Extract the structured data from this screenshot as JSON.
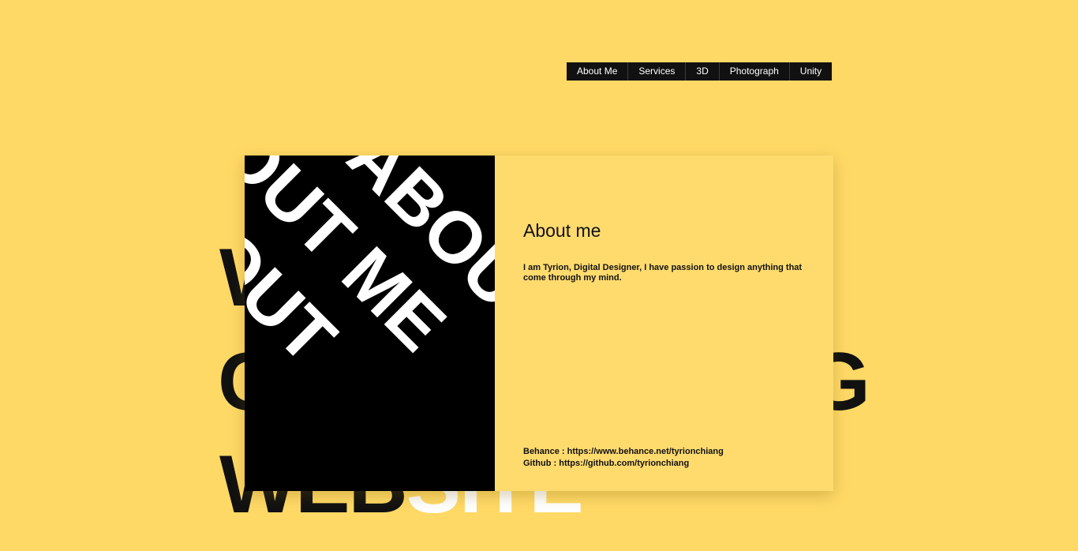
{
  "nav": {
    "items": [
      {
        "label": "About Me"
      },
      {
        "label": "Services"
      },
      {
        "label": "3D"
      },
      {
        "label": "Photograph"
      },
      {
        "label": "Unity"
      }
    ]
  },
  "background_words": {
    "line1": "W",
    "line2_left": "C",
    "line2_right": "G",
    "line3_dark": "WEB",
    "line3_light": "SITE"
  },
  "card": {
    "image_text": {
      "line1": "ABOU",
      "line2": "OUT ME",
      "line3": "BOUT"
    },
    "title": "About me",
    "description": "I am Tyrion, Digital Designer, I have passion to design anything that come through my mind.",
    "links": [
      {
        "label": "Behance",
        "url": "https://www.behance.net/tyrionchiang"
      },
      {
        "label": "Github",
        "url": "https://github.com/tyrionchiang"
      }
    ]
  },
  "colors": {
    "background": "#ffd966",
    "card_body": "#ffdb6e",
    "nav_bg": "#111111",
    "text": "#111111"
  }
}
